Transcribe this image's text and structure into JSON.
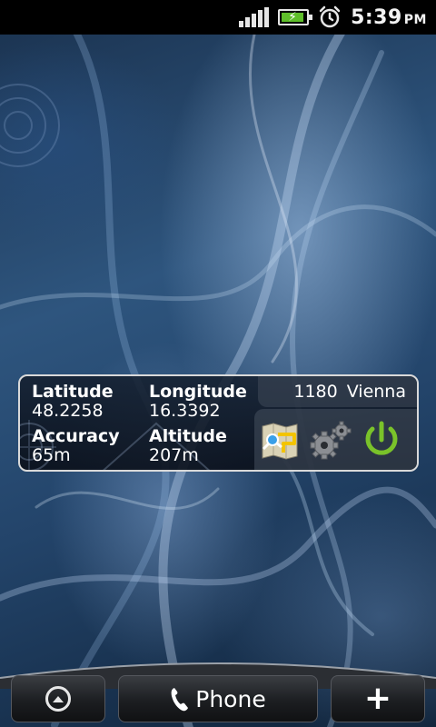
{
  "status_bar": {
    "time": "5:39",
    "ampm": "PM",
    "icons": [
      "signal-icon",
      "battery-charging-icon",
      "alarm-icon"
    ]
  },
  "widget": {
    "latitude": {
      "label": "Latitude",
      "value": "48.2258"
    },
    "longitude": {
      "label": "Longitude",
      "value": "16.3392"
    },
    "accuracy": {
      "label": "Accuracy",
      "value": "65m"
    },
    "altitude": {
      "label": "Altitude",
      "value": "207m"
    },
    "address": {
      "postcode": "1180",
      "city": "Vienna"
    },
    "actions": [
      "map-icon",
      "settings-gears-icon",
      "power-icon"
    ],
    "power_color": "#7ac22a"
  },
  "dock": {
    "phone_label": "Phone",
    "left_icon": "up-arrow-circle-icon",
    "right_icon": "plus-icon",
    "phone_icon": "phone-handset-icon"
  }
}
